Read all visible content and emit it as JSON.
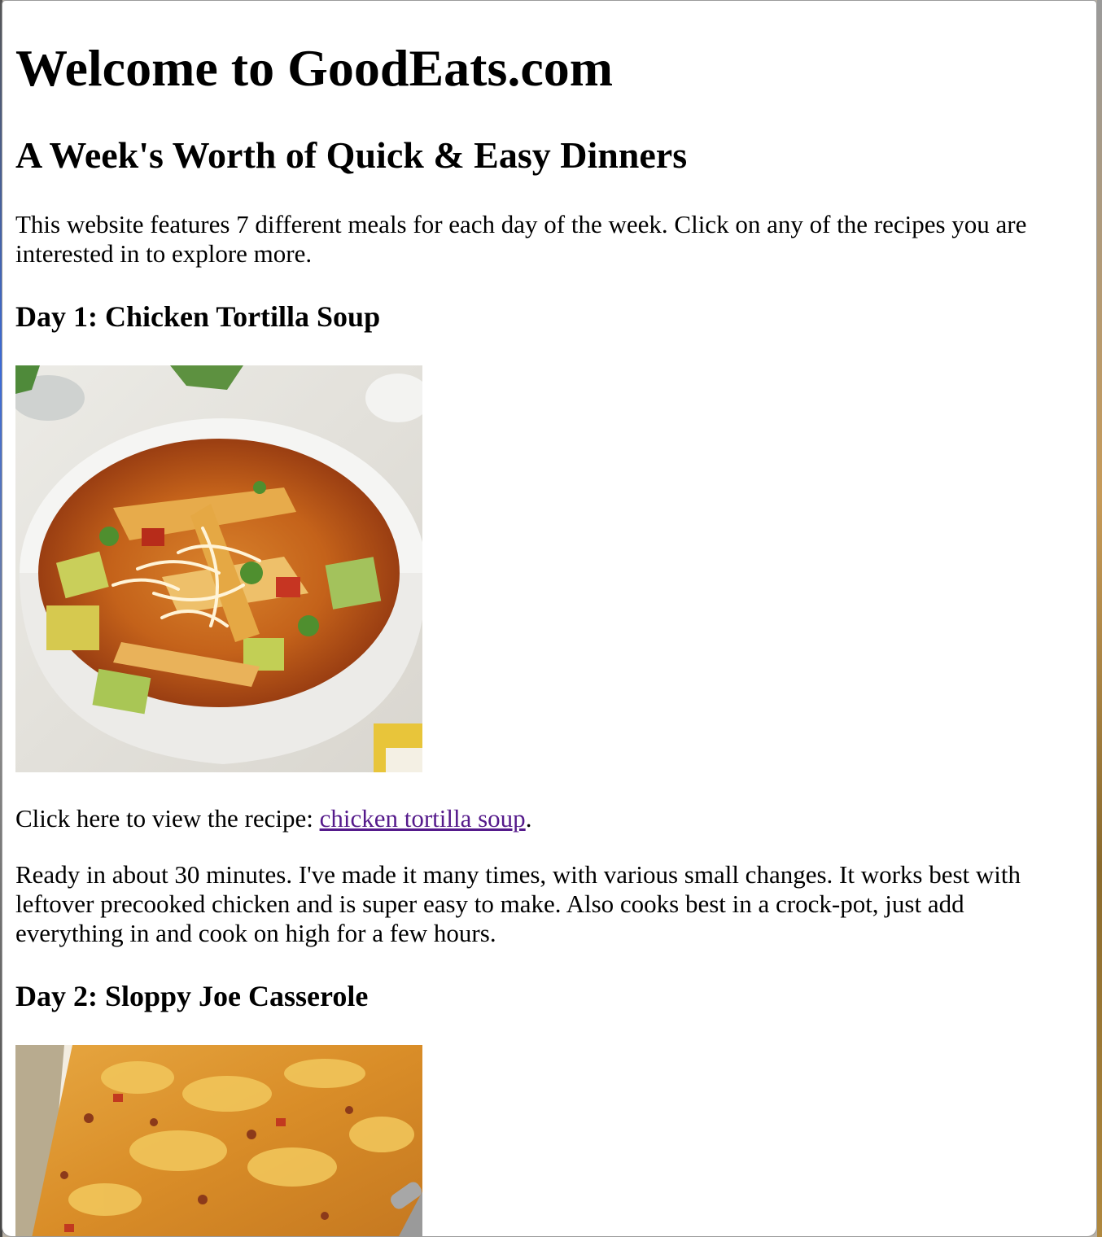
{
  "site": {
    "welcome_heading": "Welcome to GoodEats.com",
    "subheading": "A Week's Worth of Quick & Easy Dinners",
    "intro": "This website features 7 different meals for each day of the week. Click on any of the recipes you are interested in to explore more."
  },
  "days": [
    {
      "title": "Day 1: Chicken Tortilla Soup",
      "image_icon": "chicken-tortilla-soup-photo",
      "recipe_prefix": "Click here to view the recipe: ",
      "recipe_link": "chicken tortilla soup",
      "recipe_suffix": ".",
      "description": "Ready in about 30 minutes. I've made it many times, with various small changes. It works best with leftover precooked chicken and is super easy to make. Also cooks best in a crock-pot, just add everything in and cook on high for a few hours."
    },
    {
      "title": "Day 2: Sloppy Joe Casserole",
      "image_icon": "sloppy-joe-casserole-photo"
    }
  ],
  "colors": {
    "visited_link": "#551a8b",
    "text": "#000000",
    "background": "#ffffff"
  }
}
